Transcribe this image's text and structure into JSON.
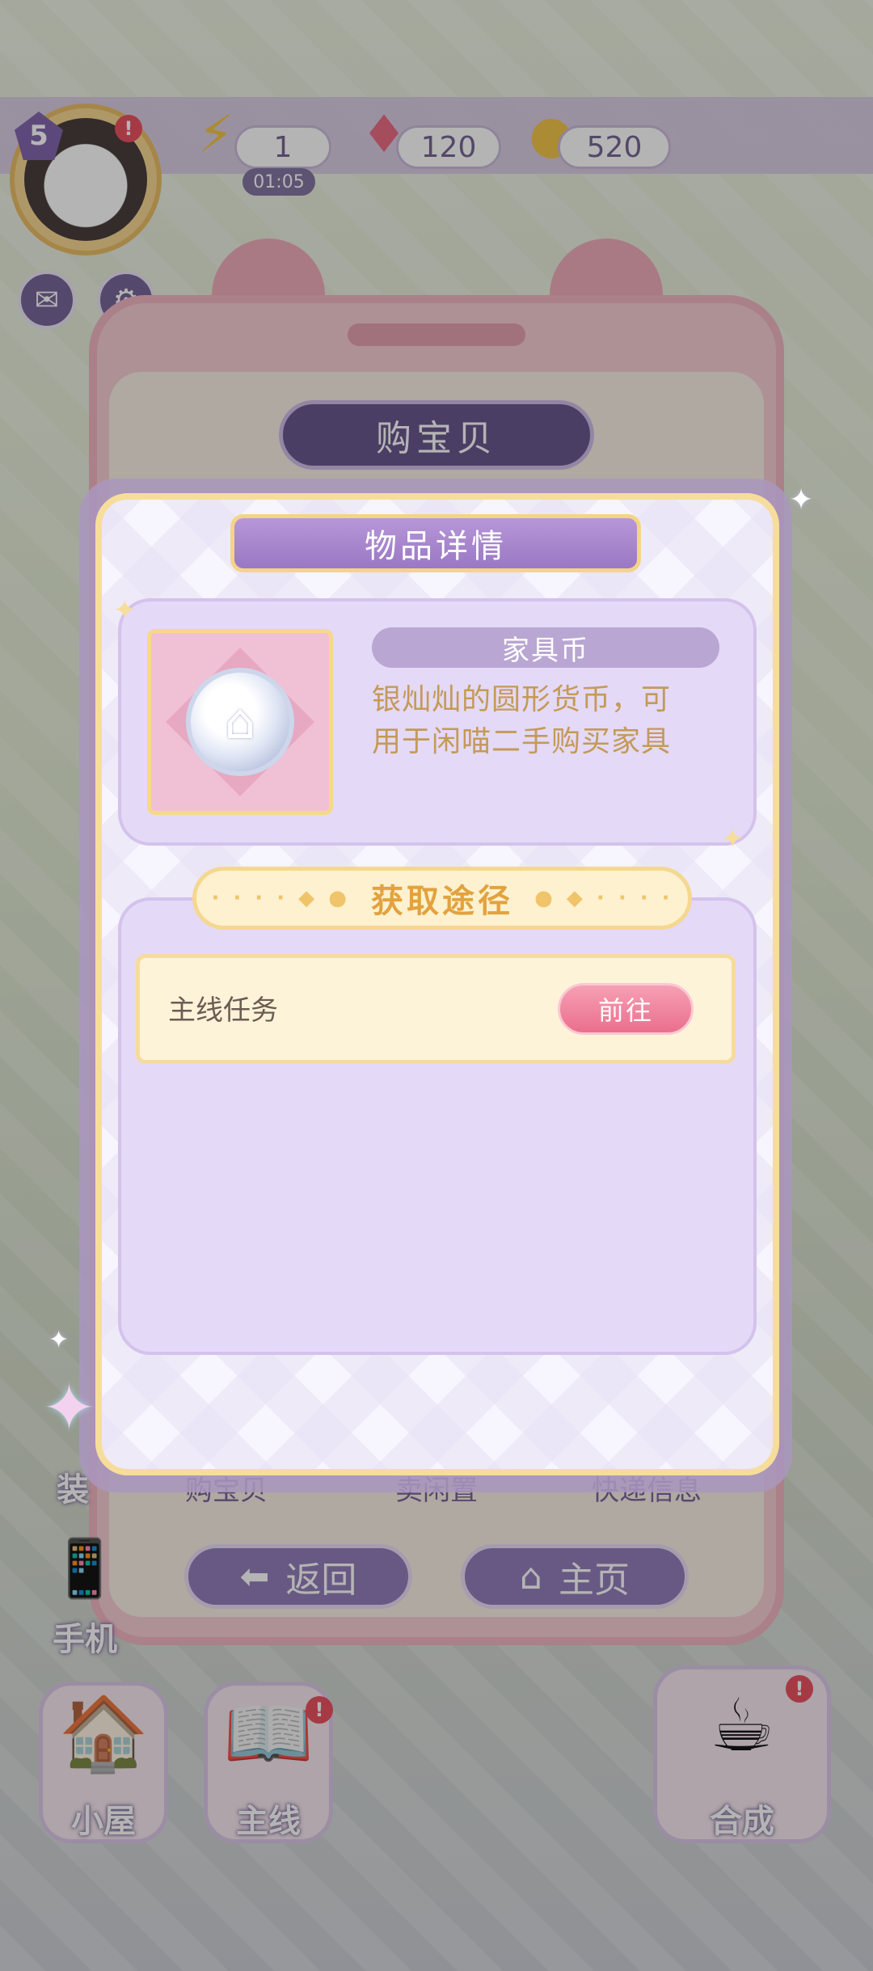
{
  "hud": {
    "level": "5",
    "alert": "!",
    "energy": "1",
    "energy_timer": "01:05",
    "gems": "120",
    "coins": "520"
  },
  "shop_panel": {
    "title": "购宝贝",
    "tabs": [
      "购宝贝",
      "卖闲置",
      "快递信息"
    ],
    "back_label": "返回",
    "home_label": "主页"
  },
  "side_menu": {
    "decor_label": "装",
    "phone_label": "手机"
  },
  "dock": {
    "house_label": "小屋",
    "main_label": "主线",
    "merge_label": "合成"
  },
  "modal": {
    "title": "物品详情",
    "item": {
      "name": "家具币",
      "description_line1": "银灿灿的圆形货币，可",
      "description_line2": "用于闲喵二手购买家具"
    },
    "acquire": {
      "title": "获取途径",
      "routes": [
        {
          "label": "主线任务",
          "button": "前往"
        }
      ]
    }
  }
}
